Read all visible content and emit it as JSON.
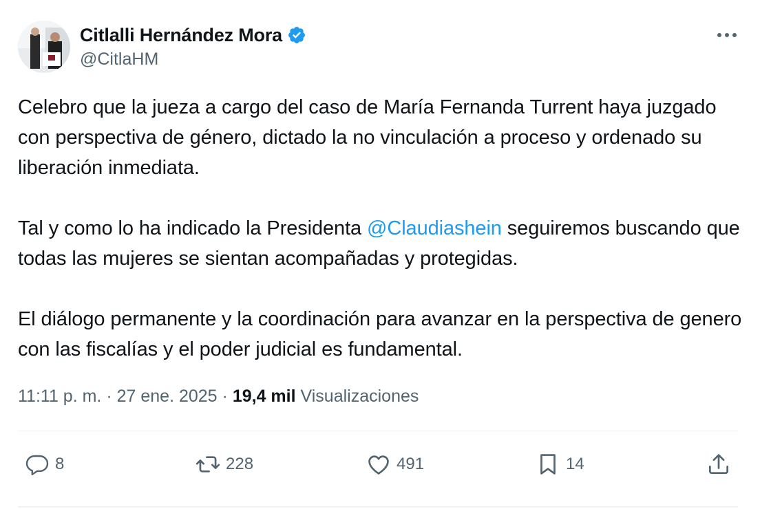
{
  "author": {
    "display_name": "Citlalli Hernández Mora",
    "handle": "@CitlaHM",
    "verified": true
  },
  "tweet": {
    "paragraph_1": "Celebro que la jueza a cargo del caso de María Fernanda Turrent haya juzgado con perspectiva de género, dictado la no vinculación a proceso y ordenado su liberación inmediata.",
    "paragraph_2_before": "Tal y como lo ha indicado la Presidenta ",
    "paragraph_2_mention": "@Claudiashein",
    "paragraph_2_after": " seguiremos buscando que todas las mujeres se sientan acompañadas y protegidas.",
    "paragraph_3": "El diálogo permanente y la coordinación para avanzar en la perspectiva de genero con las fiscalías y el poder judicial es fundamental."
  },
  "meta": {
    "time": "11:11 p. m.",
    "separator": "·",
    "date": "27 ene. 2025",
    "views_count": "19,4 mil",
    "views_label": "Visualizaciones"
  },
  "actions": {
    "replies": "8",
    "reposts": "228",
    "likes": "491",
    "bookmarks": "14"
  },
  "icons": {
    "verified": "verified-badge-icon",
    "more": "more-dots-icon",
    "reply": "reply-bubble-icon",
    "repost": "repost-arrows-icon",
    "like": "heart-icon",
    "bookmark": "bookmark-icon",
    "share": "share-upload-icon"
  },
  "colors": {
    "accent": "#1d9bf0",
    "text_primary": "#0f1419",
    "text_secondary": "#536471",
    "divider": "#eff3f4"
  }
}
